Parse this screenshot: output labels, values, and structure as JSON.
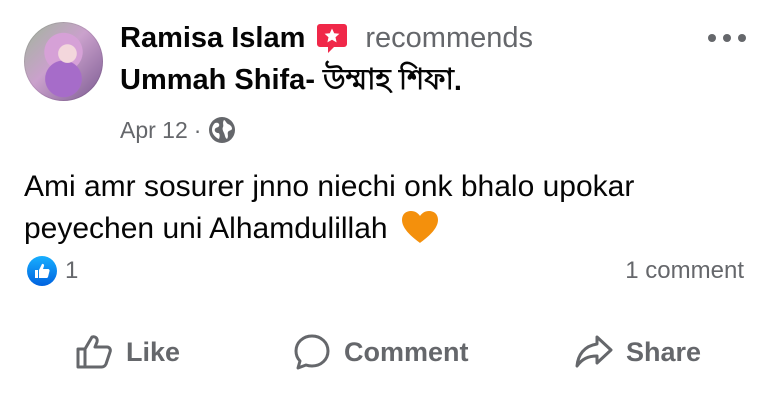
{
  "post": {
    "author": "Ramisa Islam",
    "verb": "recommends",
    "page_name": "Ummah Shifa- উম্মাহ শিফা",
    "page_name_suffix": ".",
    "date": "Apr 12",
    "separator": "·",
    "privacy_icon": "globe-icon",
    "badge_icon": "recommend-star-icon",
    "text": "Ami amr sosurer jnno niechi onk bhalo upokar peyechen uni Alhamdulillah",
    "emoji": "orange-heart"
  },
  "engagement": {
    "reaction_icon": "like-reaction-icon",
    "reaction_count": "1",
    "comment_count": "1 comment"
  },
  "actions": {
    "like_label": "Like",
    "comment_label": "Comment",
    "share_label": "Share"
  },
  "colors": {
    "text_primary": "#050505",
    "text_secondary": "#65676b",
    "like_blue": "#0866ff",
    "badge_red": "#f02849",
    "heart_orange": "#f4900c"
  }
}
